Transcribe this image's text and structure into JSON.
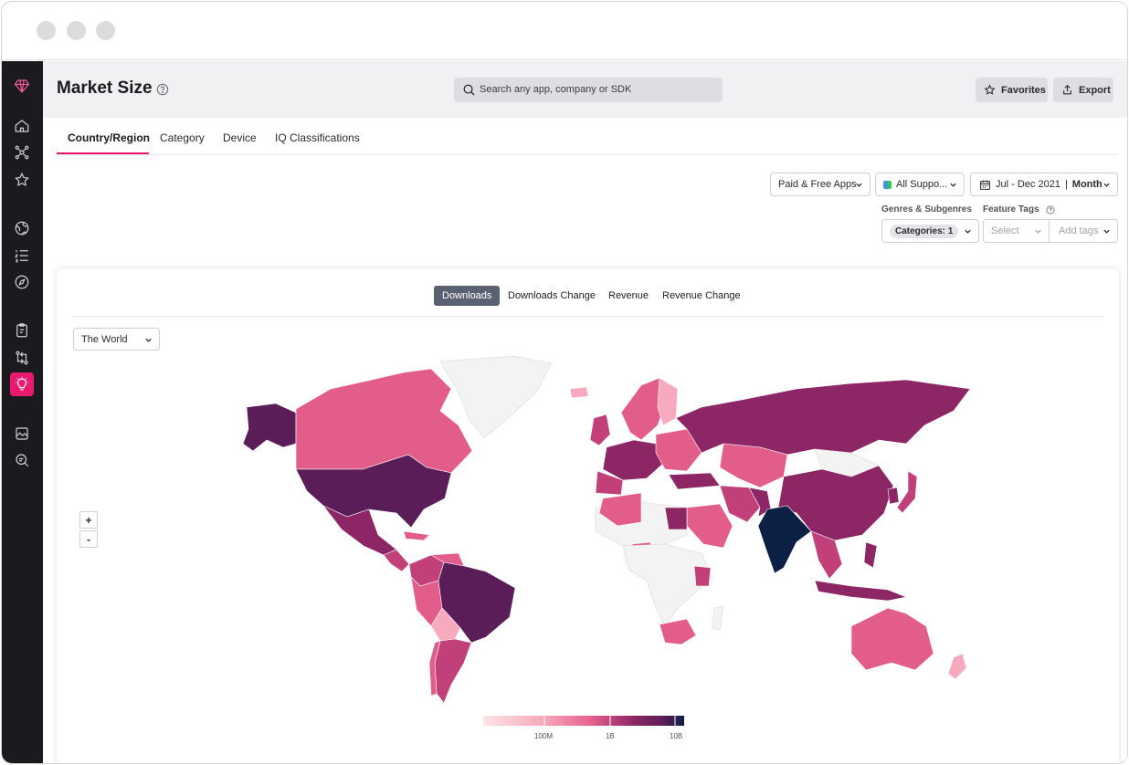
{
  "header": {
    "title": "Market Size",
    "search_placeholder": "Search any app, company or SDK",
    "favorites_label": "Favorites",
    "export_label": "Export"
  },
  "tabs": [
    {
      "label": "Country/Region",
      "active": true
    },
    {
      "label": "Category",
      "active": false
    },
    {
      "label": "Device",
      "active": false
    },
    {
      "label": "IQ Classifications",
      "active": false
    }
  ],
  "filters": {
    "app_type": "Paid & Free Apps",
    "platform": "All Suppo...",
    "date_range": "Jul - Dec 2021",
    "granularity": "Month",
    "genres_label": "Genres & Subgenres",
    "categories_chip": "Categories: 1",
    "feature_tags_label": "Feature Tags",
    "tags_select_placeholder": "Select",
    "tags_add_placeholder": "Add tags"
  },
  "metric_tabs": [
    {
      "label": "Downloads",
      "active": true
    },
    {
      "label": "Downloads Change",
      "active": false
    },
    {
      "label": "Revenue",
      "active": false
    },
    {
      "label": "Revenue Change",
      "active": false
    }
  ],
  "region_select": "The World",
  "zoom": {
    "in": "+",
    "out": "-"
  },
  "legend": {
    "ticks": [
      "100M",
      "1B",
      "10B"
    ]
  },
  "colors": {
    "accent": "#e8196f",
    "sidebar_bg": "#1b1b1f",
    "scale": [
      "#fde4e8",
      "#f7a9bd",
      "#e35d8b",
      "#c2407a",
      "#8c2665",
      "#5b1d57",
      "#0c1f45"
    ]
  }
}
